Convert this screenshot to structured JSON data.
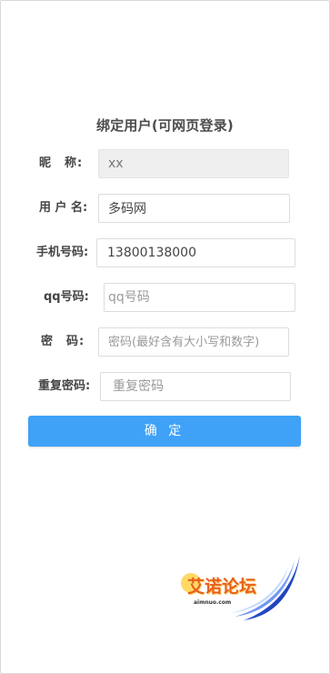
{
  "page": {
    "title": "绑定用户(可网页登录)"
  },
  "form": {
    "nickname": {
      "label": "昵　称:",
      "value": "xx"
    },
    "username": {
      "label": "用 户 名:",
      "value": "多码网"
    },
    "phone": {
      "label": "手机号码:",
      "value": "13800138000"
    },
    "qq": {
      "label": "qq号码:",
      "placeholder": "qq号码"
    },
    "password": {
      "label": "密　码:",
      "placeholder": "密码(最好含有大小写和数字)"
    },
    "confirm_password": {
      "label": "重复密码:",
      "placeholder": "重复密码"
    },
    "submit_label": "确 定"
  },
  "watermark": {
    "text": "艾诺论坛",
    "url": "aimnuo.com"
  },
  "colors": {
    "accent": "#3fa2f7",
    "readonly_bg": "#efefef",
    "watermark": "#e8601c"
  }
}
